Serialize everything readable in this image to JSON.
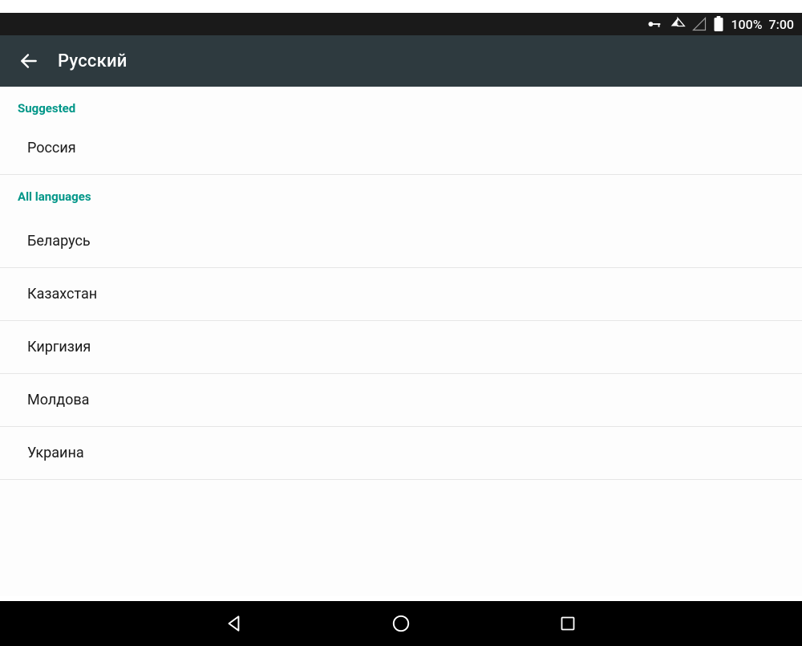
{
  "status": {
    "battery": "100%",
    "time": "7:00"
  },
  "appbar": {
    "title": "Русский"
  },
  "sections": {
    "suggestedHeader": "Suggested",
    "allHeader": "All languages"
  },
  "suggested": [
    {
      "label": "Россия"
    }
  ],
  "all": [
    {
      "label": "Беларусь"
    },
    {
      "label": "Казахстан"
    },
    {
      "label": "Киргизия"
    },
    {
      "label": "Молдова"
    },
    {
      "label": "Украина"
    }
  ]
}
